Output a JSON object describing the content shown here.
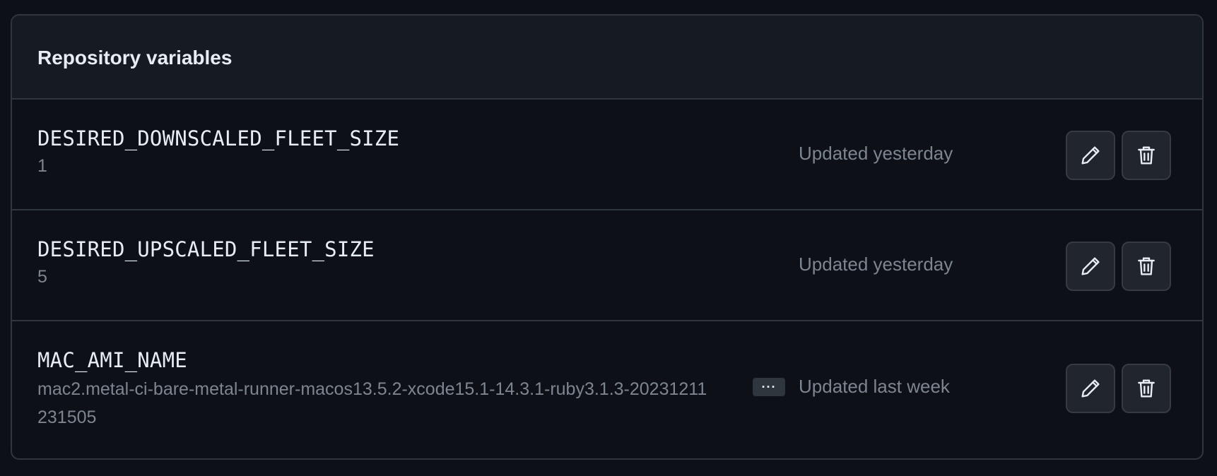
{
  "panel": {
    "title": "Repository variables"
  },
  "variables": [
    {
      "name": "DESIRED_DOWNSCALED_FLEET_SIZE",
      "value": "1",
      "updated": "Updated yesterday",
      "truncated": false
    },
    {
      "name": "DESIRED_UPSCALED_FLEET_SIZE",
      "value": "5",
      "updated": "Updated yesterday",
      "truncated": false
    },
    {
      "name": "MAC_AMI_NAME",
      "value": "mac2.metal-ci-bare-metal-runner-macos13.5.2-xcode15.1-14.3.1-ruby3.1.3-20231211231505",
      "updated": "Updated last week",
      "truncated": true,
      "ellipsis_label": "···"
    }
  ],
  "icons": {
    "edit": "pencil-icon",
    "delete": "trash-icon"
  },
  "colors": {
    "background": "#0d1117",
    "header_background": "#161b22",
    "border": "#30363d",
    "primary_text": "#e6edf3",
    "muted_text": "#7d8590",
    "button_background": "#21262d"
  }
}
